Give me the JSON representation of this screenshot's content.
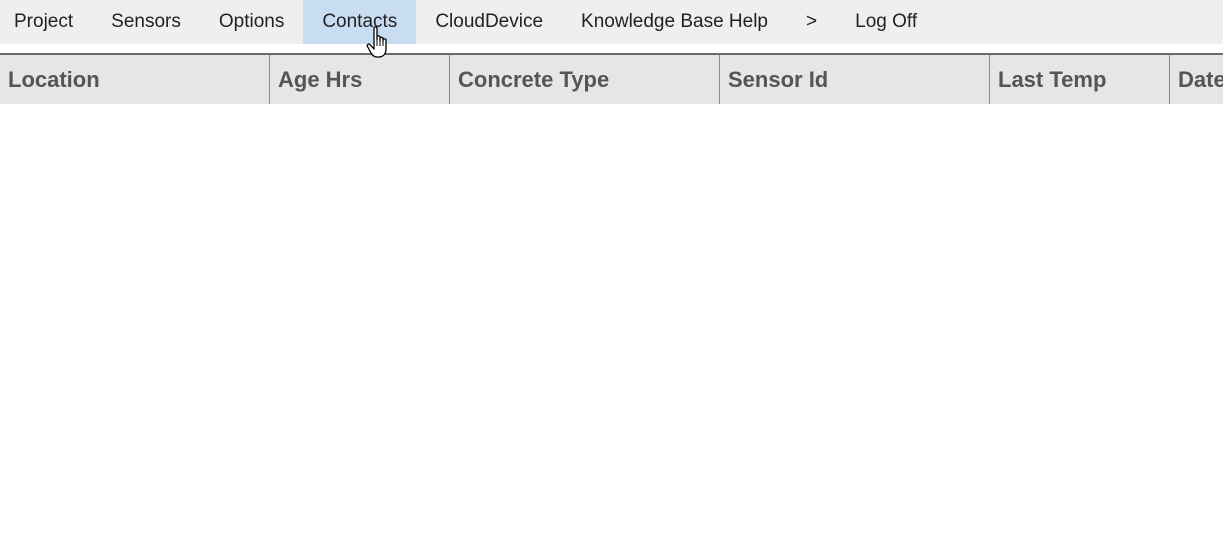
{
  "menu": {
    "items": [
      {
        "label": "Project"
      },
      {
        "label": "Sensors"
      },
      {
        "label": "Options"
      },
      {
        "label": "Contacts",
        "active": true
      },
      {
        "label": "CloudDevice"
      },
      {
        "label": "Knowledge Base Help"
      },
      {
        "label": ">"
      },
      {
        "label": "Log Off"
      }
    ]
  },
  "grid": {
    "columns": [
      {
        "label": "Location"
      },
      {
        "label": "Age Hrs"
      },
      {
        "label": "Concrete Type"
      },
      {
        "label": "Sensor Id"
      },
      {
        "label": "Last Temp"
      },
      {
        "label": "Date"
      }
    ],
    "rows": []
  },
  "cursor": {
    "icon": "hand-pointer-icon"
  },
  "colors": {
    "menubar_bg": "#efefef",
    "active_item_bg": "#c9ddf2",
    "header_bg": "#e6e6e6",
    "header_text": "#555555"
  }
}
